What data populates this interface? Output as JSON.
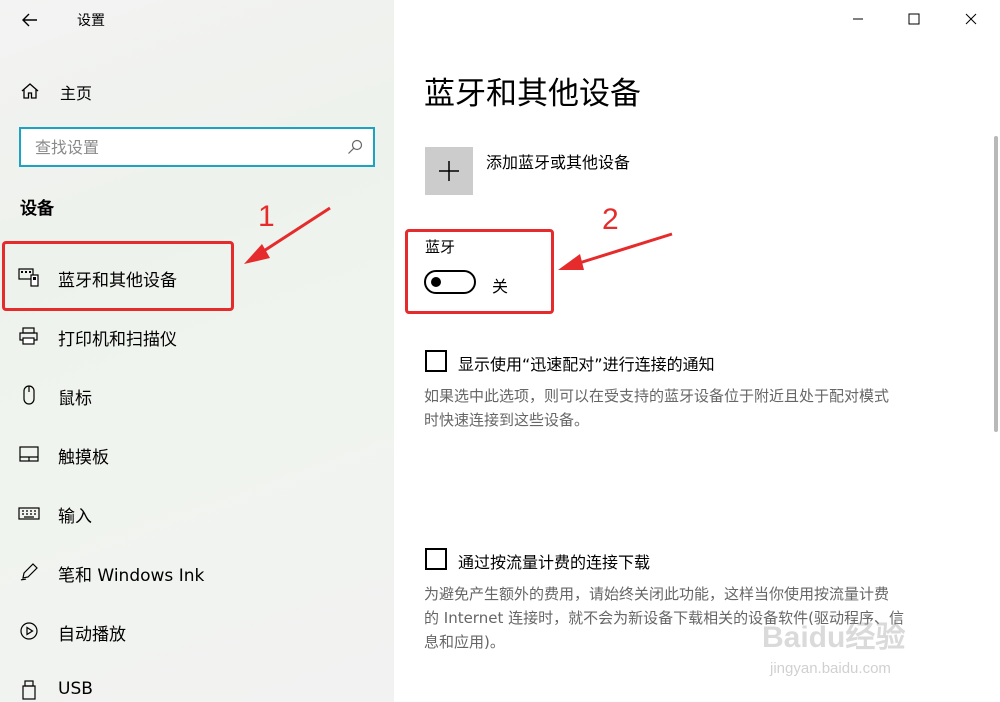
{
  "window": {
    "title": "设置",
    "minimize_icon": "minimize-icon",
    "maximize_icon": "maximize-icon",
    "close_icon": "close-icon"
  },
  "sidebar": {
    "home_label": "主页",
    "search_placeholder": "查找设置",
    "section_title": "设备",
    "items": [
      {
        "label": "蓝牙和其他设备",
        "icon": "bluetooth-devices-icon"
      },
      {
        "label": "打印机和扫描仪",
        "icon": "printer-icon"
      },
      {
        "label": "鼠标",
        "icon": "mouse-icon"
      },
      {
        "label": "触摸板",
        "icon": "touchpad-icon"
      },
      {
        "label": "输入",
        "icon": "keyboard-icon"
      },
      {
        "label": "笔和 Windows Ink",
        "icon": "pen-icon"
      },
      {
        "label": "自动播放",
        "icon": "autoplay-icon"
      },
      {
        "label": "USB",
        "icon": "usb-icon"
      }
    ]
  },
  "main": {
    "title": "蓝牙和其他设备",
    "add_device_label": "添加蓝牙或其他设备",
    "bluetooth_label": "蓝牙",
    "bluetooth_state": "关",
    "bluetooth_on": false,
    "swift_pair": {
      "label": "显示使用“迅速配对”进行连接的通知",
      "checked": false,
      "description_line1": "如果选中此选项，则可以在受支持的蓝牙设备位于附近且处于配对模式",
      "description_line2": "时快速连接到这些设备。"
    },
    "metered": {
      "label": "通过按流量计费的连接下载",
      "checked": false,
      "description_line1": "为避免产生额外的费用，请始终关闭此功能，这样当你使用按流量计费",
      "description_line2": "的 Internet 连接时，就不会为新设备下载相关的设备软件(驱动程序、信",
      "description_line3": "息和应用)。"
    }
  },
  "annotations": {
    "marker_1": "1",
    "marker_2": "2",
    "color": "#e52b2b"
  },
  "watermark": {
    "logo_text": "Baidu经验",
    "url_text": "jingyan.baidu.com"
  },
  "colors": {
    "search_border": "#1ca3c3",
    "add_button_bg": "#cccccc"
  }
}
